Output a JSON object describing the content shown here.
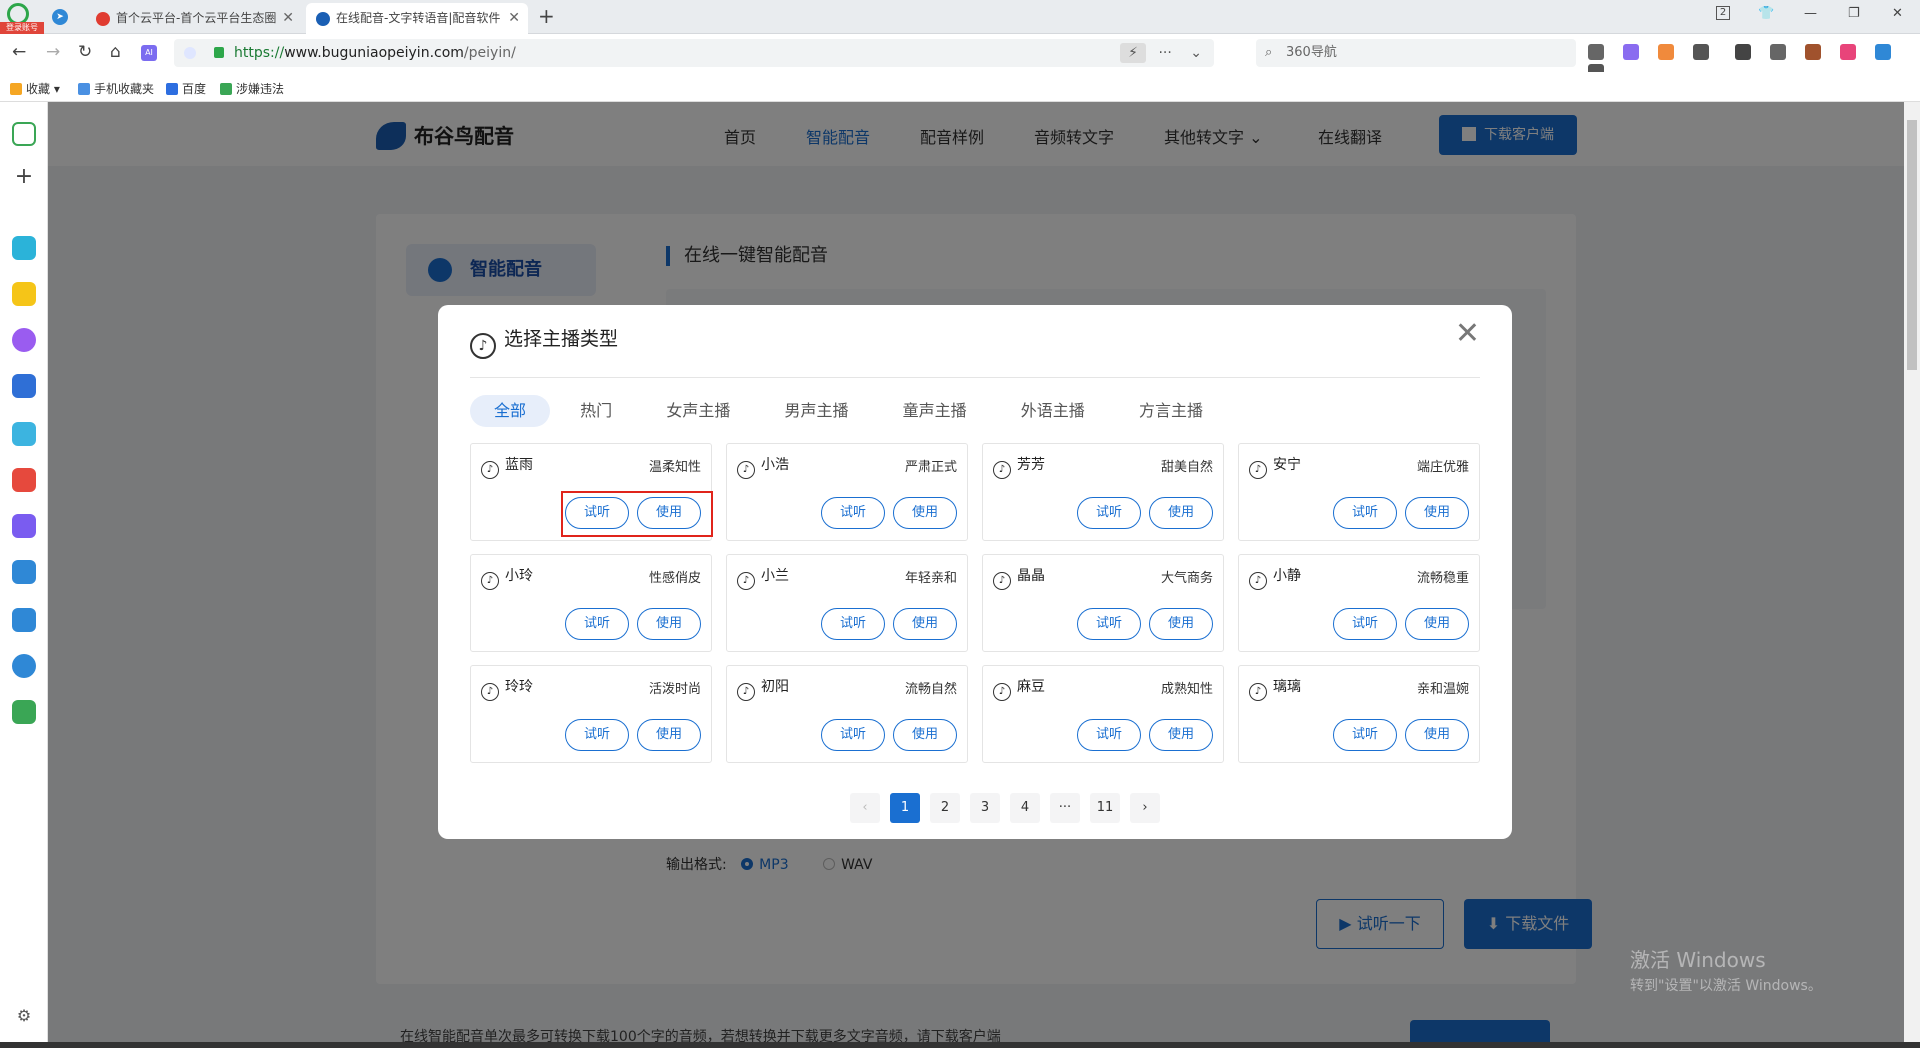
{
  "browser": {
    "account_label": "登录账号",
    "tabs": [
      {
        "title": "首个云平台-首个云平台生态圈"
      },
      {
        "title": "在线配音-文字转语音|配音软件"
      }
    ],
    "window_counter": "2",
    "url_scheme": "https://",
    "url_domain": "www.buguniaopeiyin.com",
    "url_path": "/peiyin/",
    "search_placeholder": "360导航",
    "bookmarks": [
      {
        "label": "收藏",
        "color": "#f5a623"
      },
      {
        "label": "手机收藏夹",
        "color": "#4a90e2"
      },
      {
        "label": "百度",
        "color": "#2d6ee0"
      },
      {
        "label": "涉嫌违法",
        "color": "#3aa655"
      }
    ]
  },
  "site": {
    "brand": "布谷鸟配音",
    "nav": [
      {
        "label": "首页",
        "active": false
      },
      {
        "label": "智能配音",
        "active": true
      },
      {
        "label": "配音样例",
        "active": false
      },
      {
        "label": "音频转文字",
        "active": false
      },
      {
        "label": "其他转文字",
        "active": false
      },
      {
        "label": "在线翻译",
        "active": false
      }
    ],
    "download_client": "下载客户端",
    "sidebar_item": "智能配音",
    "section_title": "在线一键智能配音",
    "output_format_label": "输出格式:",
    "formats": [
      "MP3",
      "WAV"
    ],
    "listen_button": "试听一下",
    "download_button": "下载文件",
    "footer_note": "在线智能配音单次最多可转换下载100个字的音频，若想转换并下载更多文字音频，请下载客户端"
  },
  "watermark": {
    "line1": "激活 Windows",
    "line2": "转到\"设置\"以激活 Windows。"
  },
  "modal": {
    "title": "选择主播类型",
    "categories": [
      {
        "label": "全部",
        "active": true
      },
      {
        "label": "热门",
        "active": false
      },
      {
        "label": "女声主播",
        "active": false
      },
      {
        "label": "男声主播",
        "active": false
      },
      {
        "label": "童声主播",
        "active": false
      },
      {
        "label": "外语主播",
        "active": false
      },
      {
        "label": "方言主播",
        "active": false
      }
    ],
    "try_label": "试听",
    "use_label": "使用",
    "voices": [
      {
        "name": "蓝雨",
        "tag": "温柔知性"
      },
      {
        "name": "小浩",
        "tag": "严肃正式"
      },
      {
        "name": "芳芳",
        "tag": "甜美自然"
      },
      {
        "name": "安宁",
        "tag": "端庄优雅"
      },
      {
        "name": "小玲",
        "tag": "性感俏皮"
      },
      {
        "name": "小兰",
        "tag": "年轻亲和"
      },
      {
        "name": "晶晶",
        "tag": "大气商务"
      },
      {
        "name": "小静",
        "tag": "流畅稳重"
      },
      {
        "name": "玲玲",
        "tag": "活泼时尚"
      },
      {
        "name": "初阳",
        "tag": "流畅自然"
      },
      {
        "name": "麻豆",
        "tag": "成熟知性"
      },
      {
        "name": "璃璃",
        "tag": "亲和温婉"
      }
    ],
    "pagination": {
      "prev": "‹",
      "pages": [
        "1",
        "2",
        "3",
        "4",
        "···",
        "11"
      ],
      "current": "1",
      "next": "›"
    }
  }
}
